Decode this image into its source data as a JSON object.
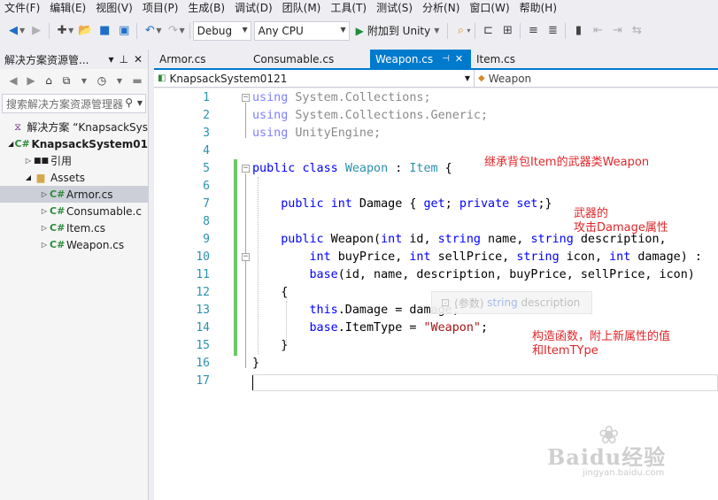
{
  "menu": [
    "文件(F)",
    "编辑(E)",
    "视图(V)",
    "项目(P)",
    "生成(B)",
    "调试(D)",
    "团队(M)",
    "工具(T)",
    "测试(S)",
    "分析(N)",
    "窗口(W)",
    "帮助(H)"
  ],
  "toolbar": {
    "config": "Debug",
    "platform": "Any CPU",
    "attach_label": "附加到 Unity"
  },
  "solution_explorer": {
    "title": "解决方案资源管...",
    "search_placeholder": "搜索解决方案资源管理器",
    "items": [
      {
        "label": "解决方案 “KnapsackSys",
        "icon": "solution-icon"
      },
      {
        "label": "KnapsackSystem01",
        "icon": "csharp-project-icon"
      },
      {
        "label": "引用",
        "icon": "references-icon"
      },
      {
        "label": "Assets",
        "icon": "folder-icon"
      },
      {
        "label": "Armor.cs",
        "icon": "csharp-file-icon"
      },
      {
        "label": "Consumable.c",
        "icon": "csharp-file-icon"
      },
      {
        "label": "Item.cs",
        "icon": "csharp-file-icon"
      },
      {
        "label": "Weapon.cs",
        "icon": "csharp-file-icon"
      }
    ]
  },
  "tabs": [
    {
      "label": "Armor.cs",
      "active": false
    },
    {
      "label": "Consumable.cs",
      "active": false
    },
    {
      "label": "Weapon.cs",
      "active": true
    },
    {
      "label": "Item.cs",
      "active": false
    }
  ],
  "navbar": {
    "project": "KnapsackSystem0121",
    "member": "Weapon"
  },
  "editor": {
    "line_numbers": [
      "1",
      "2",
      "3",
      "4",
      "5",
      "6",
      "7",
      "8",
      "9",
      "10",
      "11",
      "12",
      "13",
      "14",
      "15",
      "16",
      "17"
    ],
    "tooltip": {
      "prefix": "(参数)",
      "type": "string",
      "name": "description"
    }
  },
  "annotations": {
    "class_note": "继承背包Item的武器类Weapon",
    "attr_note_line1": "武器的",
    "attr_note_line2": "攻击Damage属性",
    "ctor_note_line1": "构造函数，附上新属性的值",
    "ctor_note_line2": "和ItemTYpe"
  },
  "watermark": {
    "brand": "Baidu经验",
    "url": "jingyan.baidu.com"
  },
  "colors": {
    "accent": "#007acc",
    "keyword": "#0000ff",
    "type": "#2b91af",
    "string": "#a31515",
    "annotation": "#e0262a",
    "change_marker": "#6cc76a"
  }
}
